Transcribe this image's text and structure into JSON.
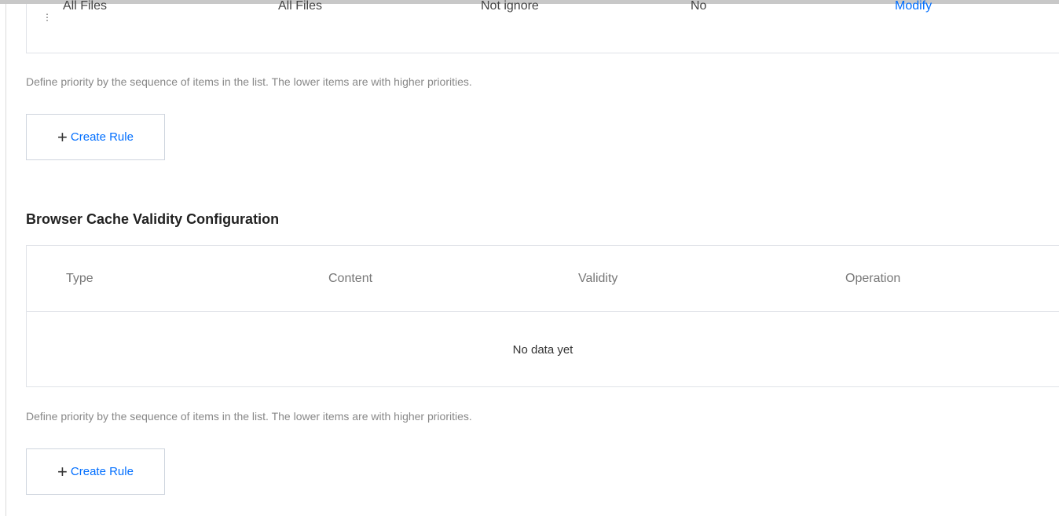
{
  "rules_table": {
    "row": {
      "type": "All Files",
      "content": "All Files",
      "ignore_param": "Not ignore",
      "flag": "No",
      "action": "Modify"
    }
  },
  "hint_text": "Define priority by the sequence of items in the list. The lower items are with higher priorities.",
  "create_rule_label": "Create Rule",
  "browser_cache": {
    "title": "Browser Cache Validity Configuration",
    "columns": [
      "Type",
      "Content",
      "Validity",
      "Operation"
    ],
    "empty_text": "No data yet"
  },
  "icons": {
    "add": "plus-icon",
    "drag": "drag-handle-icon"
  },
  "colors": {
    "link": "#006eff",
    "border": "#e0e3e8",
    "hint": "#888888"
  }
}
